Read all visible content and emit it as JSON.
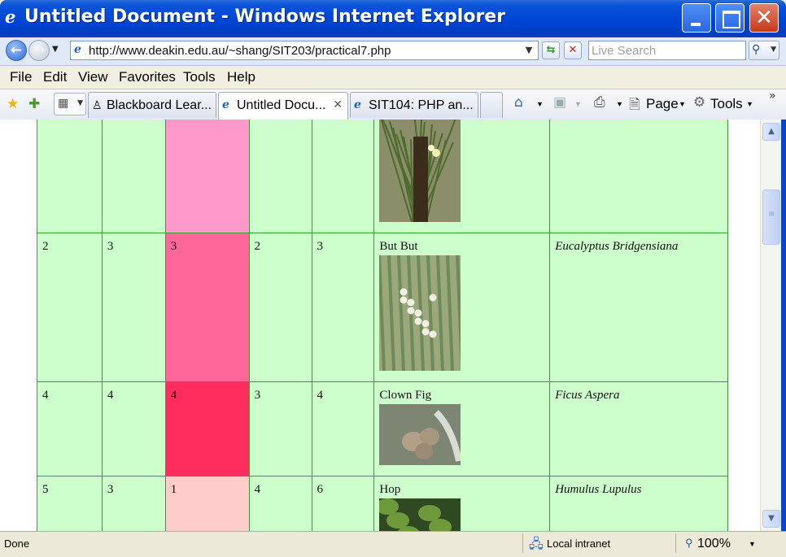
{
  "window": {
    "title": "Untitled Document - Windows Internet Explorer",
    "title_color": "#0046d6"
  },
  "address_bar": {
    "url": "http://www.deakin.edu.au/~shang/SIT203/practical7.php",
    "search_placeholder": "Live Search"
  },
  "menu": [
    "File",
    "Edit",
    "View",
    "Favorites",
    "Tools",
    "Help"
  ],
  "tabs": [
    {
      "label": "Blackboard Lear...",
      "icon": "blackboard-icon",
      "active": false
    },
    {
      "label": "Untitled Docu...",
      "icon": "ie-page-icon",
      "active": true
    },
    {
      "label": "SIT104: PHP an...",
      "icon": "ie-page-icon",
      "active": false
    }
  ],
  "command_bar": {
    "page_label": "Page",
    "tools_label": "Tools"
  },
  "table": {
    "rows": [
      {
        "cells": [
          "",
          "",
          "",
          "",
          ""
        ],
        "common_name": "",
        "scientific_name": "",
        "highlight_color": "#ff99cc",
        "photo": "grass-tree-photo"
      },
      {
        "cells": [
          "2",
          "3",
          "3",
          "2",
          "3"
        ],
        "common_name": "But But",
        "scientific_name": "Eucalyptus Bridgensiana",
        "highlight_color": "#ff6699",
        "photo": "eucalyptus-photo"
      },
      {
        "cells": [
          "4",
          "4",
          "4",
          "3",
          "4"
        ],
        "common_name": "Clown Fig",
        "scientific_name": "Ficus Aspera",
        "highlight_color": "#ff2c5e",
        "photo": "clown-fig-photo"
      },
      {
        "cells": [
          "5",
          "3",
          "1",
          "4",
          "6"
        ],
        "common_name": "Hop",
        "scientific_name": "Humulus Lupulus",
        "highlight_color": "#ffcccc",
        "photo": "hop-photo"
      }
    ],
    "cell_bg": "#ccffcc",
    "border_color": "#3a9b3a"
  },
  "status_bar": {
    "status": "Done",
    "zone": "Local intranet",
    "zoom": "100%"
  }
}
